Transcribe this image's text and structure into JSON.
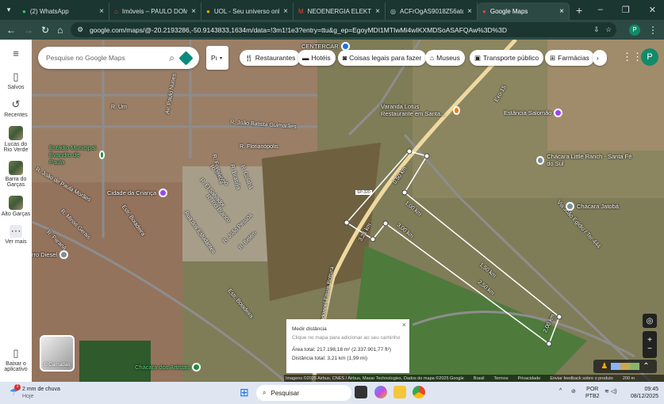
{
  "browser": {
    "tabs": [
      {
        "label": "(2) WhatsApp",
        "icon": "whatsapp-icon"
      },
      {
        "label": "Imóveis – PAULO DOMINGOS",
        "icon": "house-icon"
      },
      {
        "label": "UOL - Seu universo online",
        "icon": "uol-icon"
      },
      {
        "label": "NEOENERGIA ELEKTRO | F",
        "icon": "gmail-icon"
      },
      {
        "label": "ACFrOgAS9018Z56atqlnw",
        "icon": "globe-icon"
      },
      {
        "label": "Google Maps",
        "icon": "maps-pin-icon"
      }
    ],
    "url": "google.com/maps/@-20.2193286,-50.9143833,1634m/data=!3m1!1e3?entry=ttu&g_ep=EgoyMDI1MTIwMi4wIKXMDSoASAFQAw%3D%3D",
    "profile": "P"
  },
  "sidebar": {
    "items": [
      {
        "label": "Salvos"
      },
      {
        "label": "Recentes"
      },
      {
        "label": "Lucas do Rio Verde"
      },
      {
        "label": "Barra do Garças"
      },
      {
        "label": "Alto Garças"
      },
      {
        "label": "Ver mais"
      },
      {
        "label": "Baixar o aplicativo"
      }
    ]
  },
  "search": {
    "placeholder": "Pesquise no Google Maps"
  },
  "filters": {
    "partial": "Pı",
    "chips": [
      "Restaurantes",
      "Hotéis",
      "Coisas legais para fazer",
      "Museus",
      "Transporte público",
      "Farmácias"
    ]
  },
  "map": {
    "streets": [
      "R. Um",
      "R. João Batista Guimarães",
      "R. Florianópolis",
      "R. Maceió",
      "R. El Salvador",
      "R. Rio Branco",
      "Rua dos Estudantes",
      "R. João Pessoa",
      "R. Belém",
      "R. João de Paula Morães",
      "Estr. Boiadeira",
      "R. Paraná",
      "R. Minas Gerais",
      "Via João Egídio / Ter-444",
      "Rodoanel Ettore Bottura",
      "Estr. Boiadeira",
      "R. Cuiabá",
      "R. Brasília",
      "R. Fortaleza",
      "Av. Paulo Nunes",
      "Exo-15"
    ],
    "places": [
      "Estádio Municipal Evandro de Paula",
      "Cidade da Criança",
      "Varanda Lotus Restaurante em Santa...",
      "Estância Salomão",
      "Chácara Little Ranch - Santa Fé do Sul",
      "Chácara Jatobá",
      "Chácara dos Artistas",
      "CENTERCAR",
      "rro Diesel"
    ],
    "distance_labels": [
      "0,50 km",
      "1,00 km",
      "1,50 km",
      "2,00 km",
      "2,50 km",
      "3,00 km",
      "3,21 km"
    ],
    "road_badge": "SP-320"
  },
  "measure": {
    "title": "Medir distância",
    "hint": "Clique no mapa para adicionar ao seu caminho",
    "area": "Área total: 217.198,18 m² (2.337.901,77 ft²)",
    "distance": "Distância total: 3,21 km (1,99 mi)"
  },
  "layers_label": "Camadas",
  "attribution": {
    "imagery": "Imagens ©2025 Airbus, CNES / Airbus, Maxar Technologies, Dados do mapa ©2025 Google",
    "country": "Brasil",
    "terms": "Termos",
    "privacy": "Privacidade",
    "feedback": "Enviar feedback sobre o produto",
    "scale": "200 m"
  },
  "taskbar": {
    "weather": "2 mm de chuva",
    "weather_sub": "Hoje",
    "weather_badge": "1",
    "search": "Pesquisar",
    "lang1": "POR",
    "lang2": "PTB2",
    "time": "09:45",
    "date": "08/12/2025"
  }
}
